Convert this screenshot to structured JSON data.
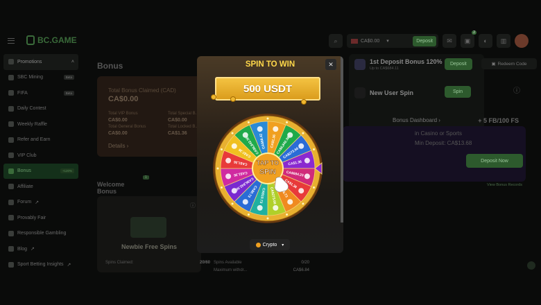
{
  "app": {
    "logo_text": "BC.GAME"
  },
  "topbar": {
    "balance": "CA$0.00",
    "deposit_label": "Deposit",
    "notification_count": "2"
  },
  "sidebar": {
    "items": [
      {
        "label": "Promotions",
        "tag": ""
      },
      {
        "label": "SBC Mining",
        "tag": "Beta"
      },
      {
        "label": "FIFA",
        "tag": "Beta"
      },
      {
        "label": "Daily Contest",
        "tag": ""
      },
      {
        "label": "Weekly Raffle",
        "tag": ""
      },
      {
        "label": "Refer and Earn",
        "tag": ""
      },
      {
        "label": "VIP Club",
        "tag": ""
      },
      {
        "label": "Bonus",
        "tag": "+120%"
      },
      {
        "label": "Affiliate",
        "tag": ""
      },
      {
        "label": "Forum",
        "tag": ""
      },
      {
        "label": "Provably Fair",
        "tag": ""
      },
      {
        "label": "Responsible Gambling",
        "tag": ""
      },
      {
        "label": "Blog",
        "tag": ""
      },
      {
        "label": "Sport Betting Insights",
        "tag": ""
      }
    ]
  },
  "main": {
    "title": "Bonus",
    "claimed": {
      "label": "Total Bonus Claimed (CAD)",
      "value": "CA$0.00",
      "rows": [
        {
          "label": "Total VIP Bonus",
          "value": "CA$0.00"
        },
        {
          "label": "Total Special B...",
          "value": "CA$0.00"
        },
        {
          "label": "Total General Bonus",
          "value": "CA$0.00"
        },
        {
          "label": "Total Locked B...",
          "value": "CA$1.36"
        }
      ],
      "details": "Details ›"
    },
    "welcome_title": "Welcome Bonus",
    "welcome_count": "1",
    "newbie": {
      "title": "Newbie Free Spins",
      "claimed_label": "Spins Claimed:",
      "claimed_value": "20/60"
    },
    "other": {
      "r1_label": "Spins Available",
      "r1_value": "0/20",
      "r2_label": "Maximum withdr...",
      "r2_value": "CA$6.84"
    }
  },
  "deposit_panel": {
    "title": "1st Deposit Bonus 120%",
    "subtitle": "Up to CA$684.11",
    "deposit_label": "Deposit",
    "spin_title": "New User Spin",
    "spin_label": "Spin",
    "dashboard": "Bonus Dashboard ›",
    "redeem": "Redeem Code",
    "promo_line1": "in Casino or Sports",
    "promo_line2": "Min Deposit: CA$13.68",
    "promo_fs": "+ 5 FB/100 FS",
    "deposit_now": "Deposit Now",
    "view_records": "View Bonus Records"
  },
  "modal": {
    "title": "SPIN TO WIN",
    "prize": "500 USDT",
    "center_line1": "TAP TO",
    "center_line2": "SPIN",
    "currency": "Crypto",
    "segments": [
      "CA$1.36",
      "CA$6,842.36",
      "CA$273.66",
      "CA$1.36",
      "CA$684.23",
      "CA$1.36",
      "CA$6.73",
      "CA$273.66",
      "CA$10.73",
      "CA$0.73",
      "CA$6,842.36",
      "CA$1.36",
      "CA$1.36",
      "CA$7.36",
      "CA$6,842.36",
      "CA$68.42"
    ],
    "segment_colors": [
      "#f0a020",
      "#1faa4a",
      "#2a6cd6",
      "#8a2ad0",
      "#d02a7a",
      "#e83a3a",
      "#f08a20",
      "#b0d02a",
      "#1fb0a0",
      "#2a6cd6",
      "#7a2ad0",
      "#d02aa0",
      "#e83a3a",
      "#f0c020",
      "#1faa4a",
      "#2a8ad6"
    ]
  }
}
